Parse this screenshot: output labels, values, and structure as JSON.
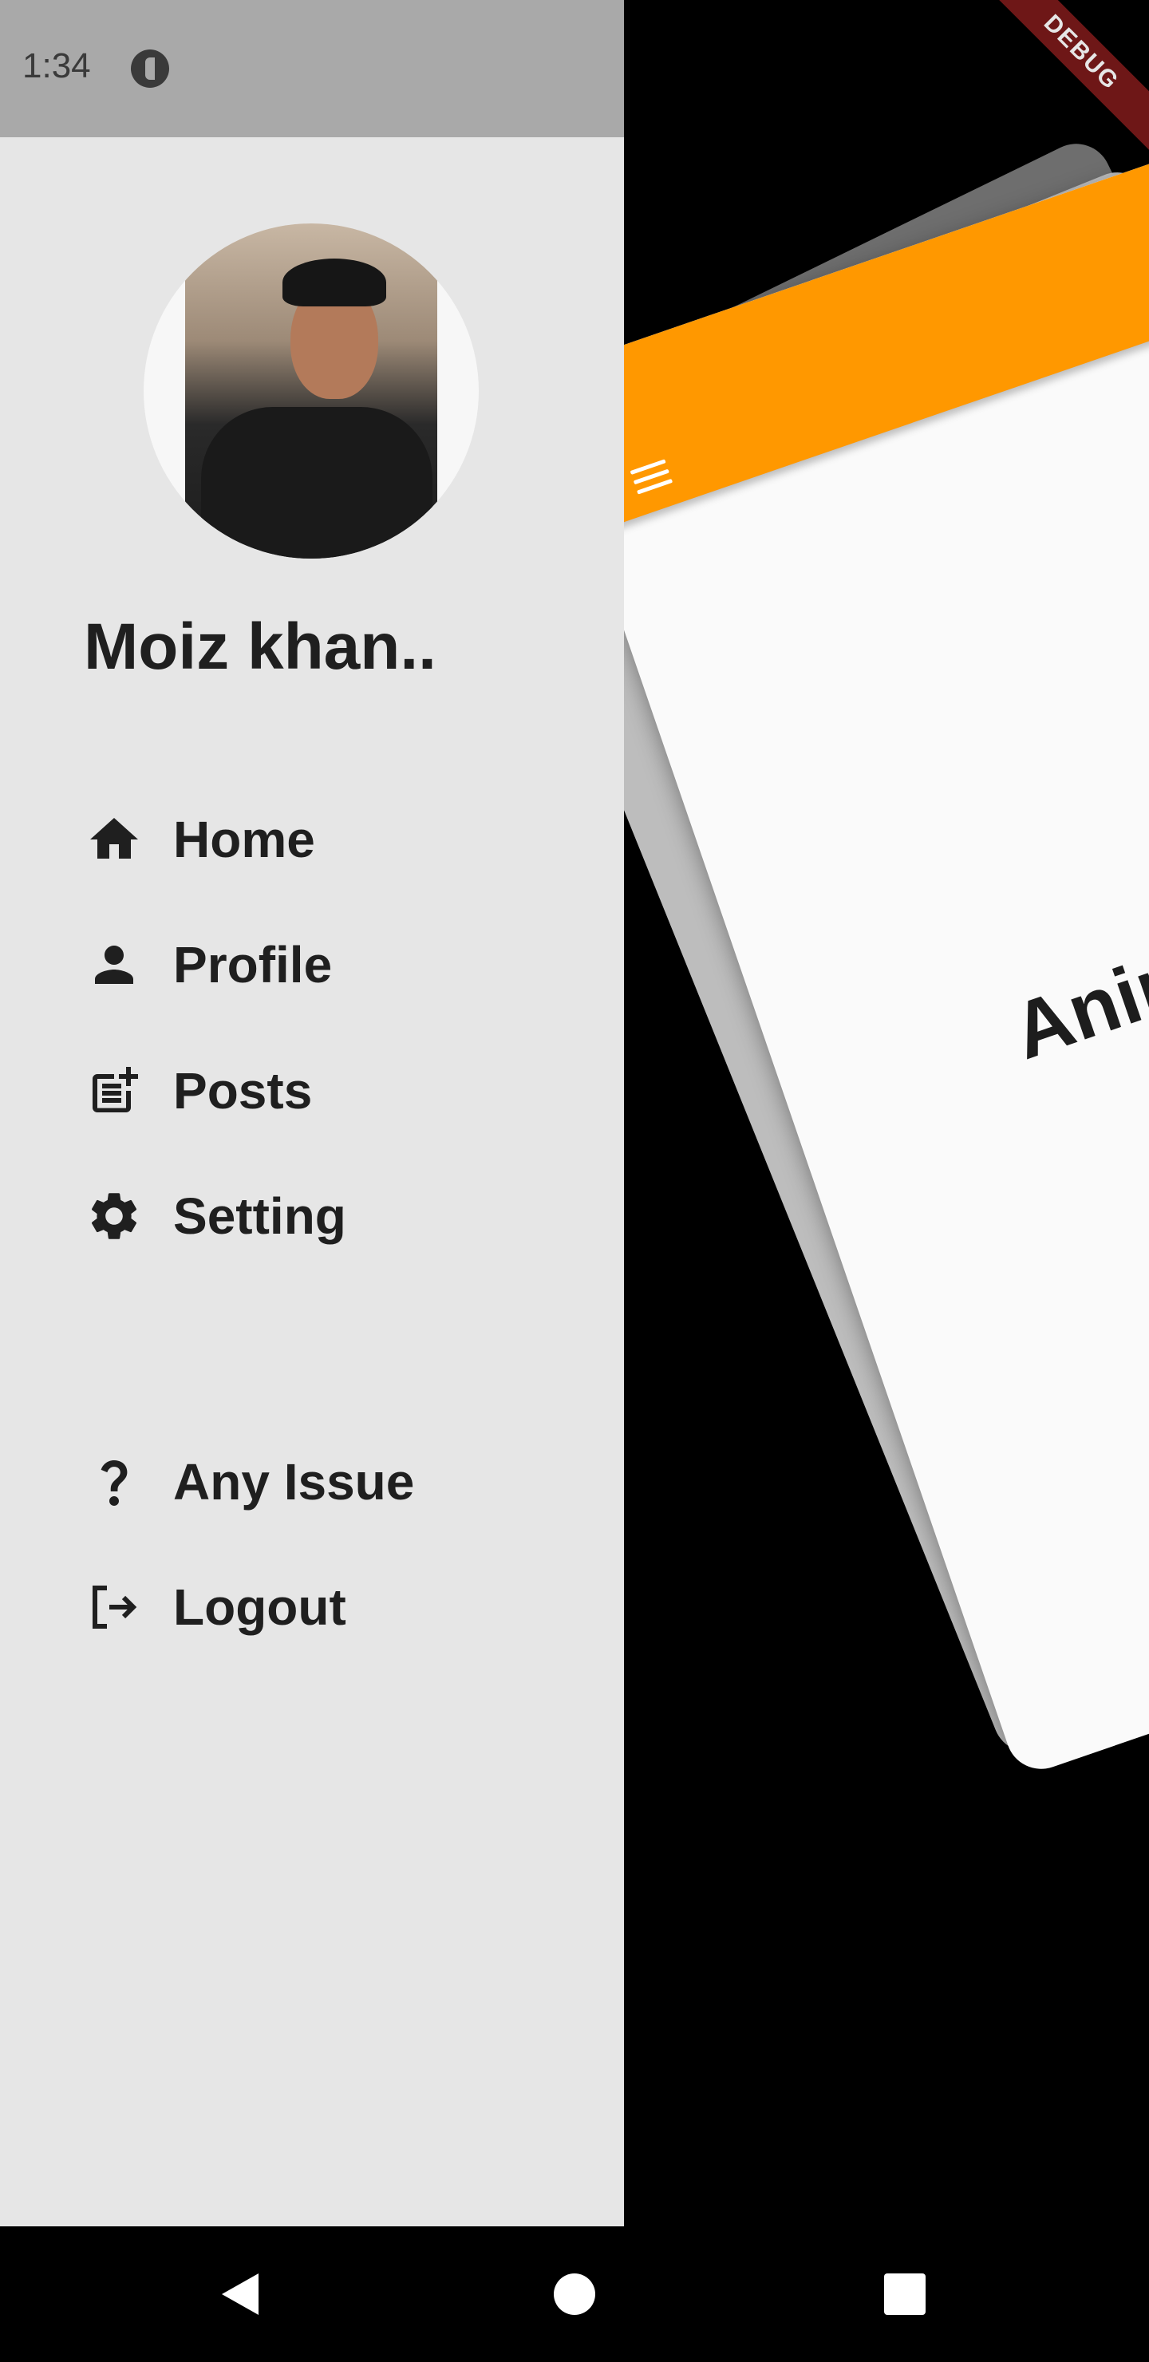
{
  "status_bar": {
    "time": "1:34",
    "icon": "app-indicator-icon"
  },
  "debug_banner": "DEBUG",
  "drawer": {
    "user_name": "Moiz khan..",
    "menu": [
      {
        "label": "Home",
        "icon": "home-icon"
      },
      {
        "label": "Profile",
        "icon": "person-icon"
      },
      {
        "label": "Posts",
        "icon": "post-add-icon"
      },
      {
        "label": "Setting",
        "icon": "gear-icon"
      }
    ],
    "secondary_menu": [
      {
        "label": "Any Issue",
        "icon": "question-icon"
      },
      {
        "label": "Logout",
        "icon": "logout-icon"
      }
    ]
  },
  "main": {
    "title": "Animate",
    "app_bar_color": "#ff9800"
  },
  "nav_bar": {
    "back": "back-icon",
    "home": "home-circle-icon",
    "recents": "recents-square-icon"
  }
}
